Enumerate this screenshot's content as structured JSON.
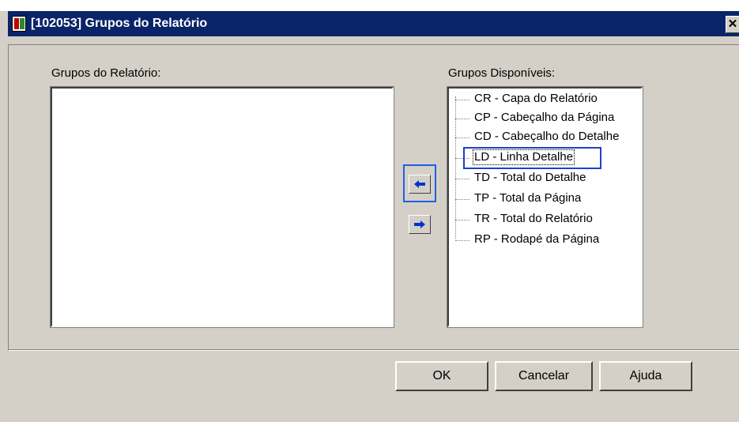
{
  "window": {
    "title": "[102053] Grupos do Relatório",
    "close_glyph": "✕"
  },
  "left_panel": {
    "label": "Grupos do Relatório:",
    "items": []
  },
  "right_panel": {
    "label": "Grupos Disponíveis:",
    "items": [
      {
        "label": "CR - Capa do Relatório"
      },
      {
        "label": "CP - Cabeçalho da Página"
      },
      {
        "label": "CD - Cabeçalho do Detalhe"
      },
      {
        "label": "LD - Linha Detalhe",
        "selected": true
      },
      {
        "label": "TD - Total do Detalhe"
      },
      {
        "label": "TP - Total da Página"
      },
      {
        "label": "TR - Total do Relatório"
      },
      {
        "label": "RP - Rodapé da Página"
      }
    ]
  },
  "transfer": {
    "add_icon": "arrow-left-icon",
    "remove_icon": "arrow-right-icon",
    "arrow_color": "#0033cc"
  },
  "buttons": {
    "ok": "OK",
    "cancel": "Cancelar",
    "help": "Ajuda"
  }
}
